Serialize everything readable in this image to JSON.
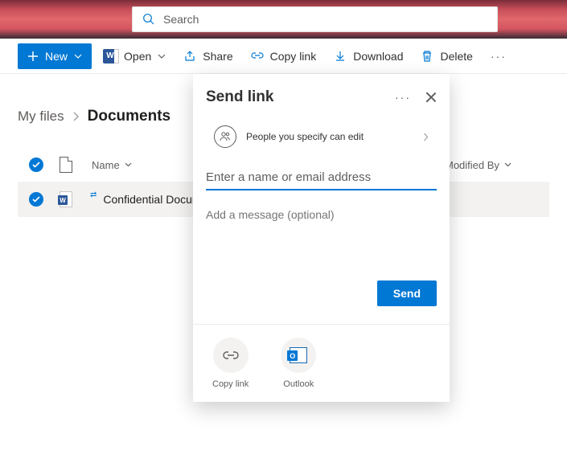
{
  "search": {
    "placeholder": "Search"
  },
  "toolbar": {
    "new": "New",
    "open": "Open",
    "share": "Share",
    "copy_link": "Copy link",
    "download": "Download",
    "delete": "Delete"
  },
  "breadcrumb": {
    "parent": "My files",
    "current": "Documents"
  },
  "columns": {
    "name": "Name",
    "modified_by": "Modified By"
  },
  "rows": [
    {
      "filename": "Confidential Docum"
    }
  ],
  "dialog": {
    "title": "Send link",
    "permission": "People you specify can edit",
    "name_placeholder": "Enter a name or email address",
    "message_placeholder": "Add a message (optional)",
    "send": "Send",
    "copy_link": "Copy link",
    "outlook": "Outlook"
  }
}
